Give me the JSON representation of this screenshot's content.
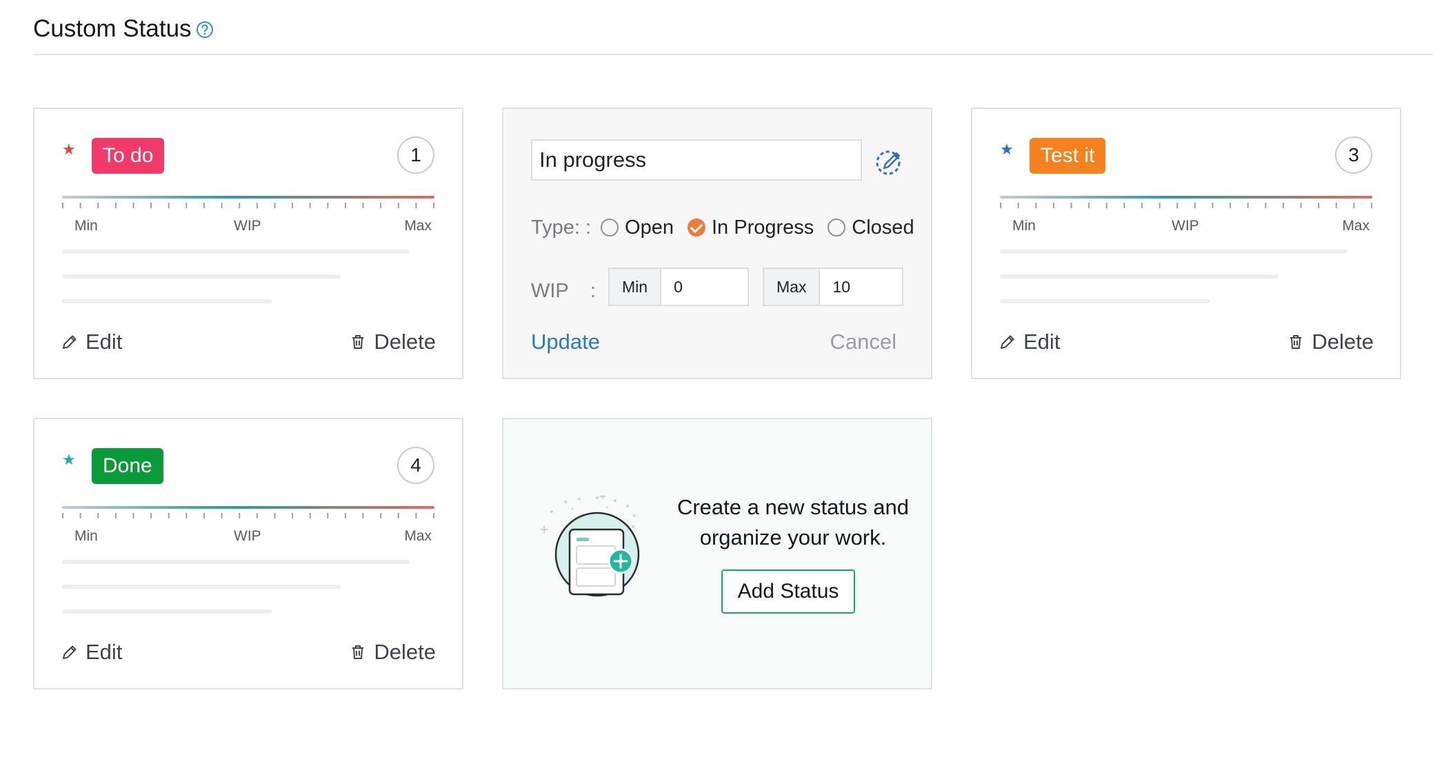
{
  "page": {
    "title": "Custom Status",
    "help_icon": "question-circle-icon"
  },
  "colors": {
    "todo": "#f23a6a",
    "testit": "#f5821f",
    "done": "#0b9a3a",
    "accent": "#2a78c7",
    "radio_checked": "#f0793a"
  },
  "cards": [
    {
      "tag": "To do",
      "count": "1",
      "star_color": "#e2473b",
      "labels": {
        "min": "Min",
        "wip": "WIP",
        "max": "Max"
      },
      "edit": "Edit",
      "delete": "Delete"
    },
    {
      "tag": "Test it",
      "count": "3",
      "star_color": "#2a6fc4",
      "labels": {
        "min": "Min",
        "wip": "WIP",
        "max": "Max"
      },
      "edit": "Edit",
      "delete": "Delete"
    },
    {
      "tag": "Done",
      "count": "4",
      "star_color": "#16b3a0",
      "labels": {
        "min": "Min",
        "wip": "WIP",
        "max": "Max"
      },
      "edit": "Edit",
      "delete": "Delete"
    }
  ],
  "edit_form": {
    "name_value": "In progress",
    "type_label": "Type: :",
    "types": [
      "Open",
      "In Progress",
      "Closed"
    ],
    "selected_type": "In Progress",
    "wip_label": "WIP",
    "wip_colon": ":",
    "min_prefix": "Min",
    "min_value": "0",
    "max_prefix": "Max",
    "max_value": "10",
    "update": "Update",
    "cancel": "Cancel"
  },
  "add_card": {
    "line1": "Create a new status and",
    "line2": "organize your work.",
    "button": "Add Status"
  }
}
